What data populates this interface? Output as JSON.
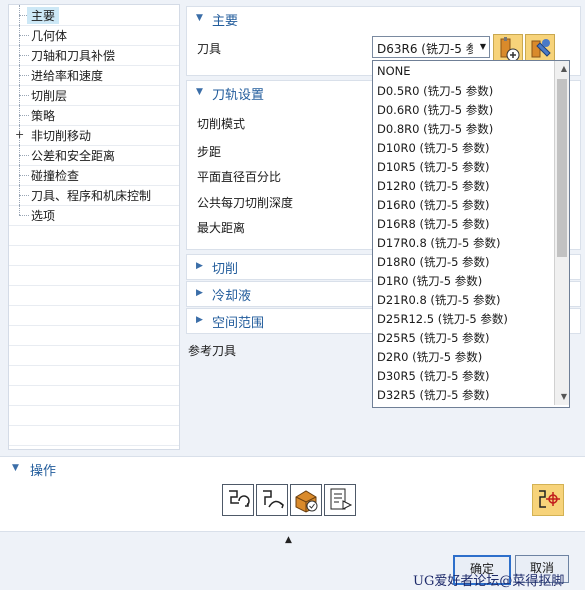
{
  "tree": {
    "items": [
      {
        "label": "主要",
        "selected": true,
        "expand": false
      },
      {
        "label": "几何体",
        "selected": false,
        "expand": false
      },
      {
        "label": "刀轴和刀具补偿",
        "selected": false,
        "expand": false
      },
      {
        "label": "进给率和速度",
        "selected": false,
        "expand": false
      },
      {
        "label": "切削层",
        "selected": false,
        "expand": false
      },
      {
        "label": "策略",
        "selected": false,
        "expand": false
      },
      {
        "label": "非切削移动",
        "selected": false,
        "expand": true
      },
      {
        "label": "公差和安全距离",
        "selected": false,
        "expand": false
      },
      {
        "label": "碰撞检查",
        "selected": false,
        "expand": false
      },
      {
        "label": "刀具、程序和机床控制",
        "selected": false,
        "expand": false
      },
      {
        "label": "选项",
        "selected": false,
        "expand": false
      }
    ]
  },
  "main_section": {
    "title": "主要",
    "tool_label": "刀具",
    "tool_value": "D63R6 (铣刀-5 参"
  },
  "toolpath_section": {
    "title": "刀轨设置",
    "fields": [
      "切削模式",
      "步距",
      "平面直径百分比",
      "公共每刀切削深度",
      "最大距离"
    ]
  },
  "collapsed_sections": [
    "切削",
    "冷却液",
    "空间范围"
  ],
  "reference_tool_label": "参考刀具",
  "dropdown": {
    "items": [
      "NONE",
      "D0.5R0 (铣刀-5 参数)",
      "D0.6R0 (铣刀-5 参数)",
      "D0.8R0 (铣刀-5 参数)",
      "D10R0 (铣刀-5 参数)",
      "D10R5 (铣刀-5 参数)",
      "D12R0 (铣刀-5 参数)",
      "D16R0 (铣刀-5 参数)",
      "D16R8 (铣刀-5 参数)",
      "D17R0.8 (铣刀-5 参数)",
      "D18R0 (铣刀-5 参数)",
      "D1R0 (铣刀-5 参数)",
      "D21R0.8 (铣刀-5 参数)",
      "D25R12.5 (铣刀-5 参数)",
      "D25R5 (铣刀-5 参数)",
      "D2R0 (铣刀-5 参数)",
      "D30R5 (铣刀-5 参数)",
      "D32R5 (铣刀-5 参数)"
    ]
  },
  "operations": {
    "title": "操作"
  },
  "footer": {
    "ok": "确定",
    "cancel": "取消"
  },
  "watermark": "UG爱好者论坛@菜得抠脚",
  "colors": {
    "accent": "#235d9c",
    "selection": "#cde8f6",
    "icon_yellow": "#f7d37a"
  },
  "icons": [
    "triangle-collapse-icon",
    "triangle-expand-icon",
    "new-tool-icon",
    "edit-tool-icon",
    "generate-icon",
    "replay-icon",
    "verify-icon",
    "list-icon",
    "display-icon",
    "chevron-up-icon"
  ]
}
